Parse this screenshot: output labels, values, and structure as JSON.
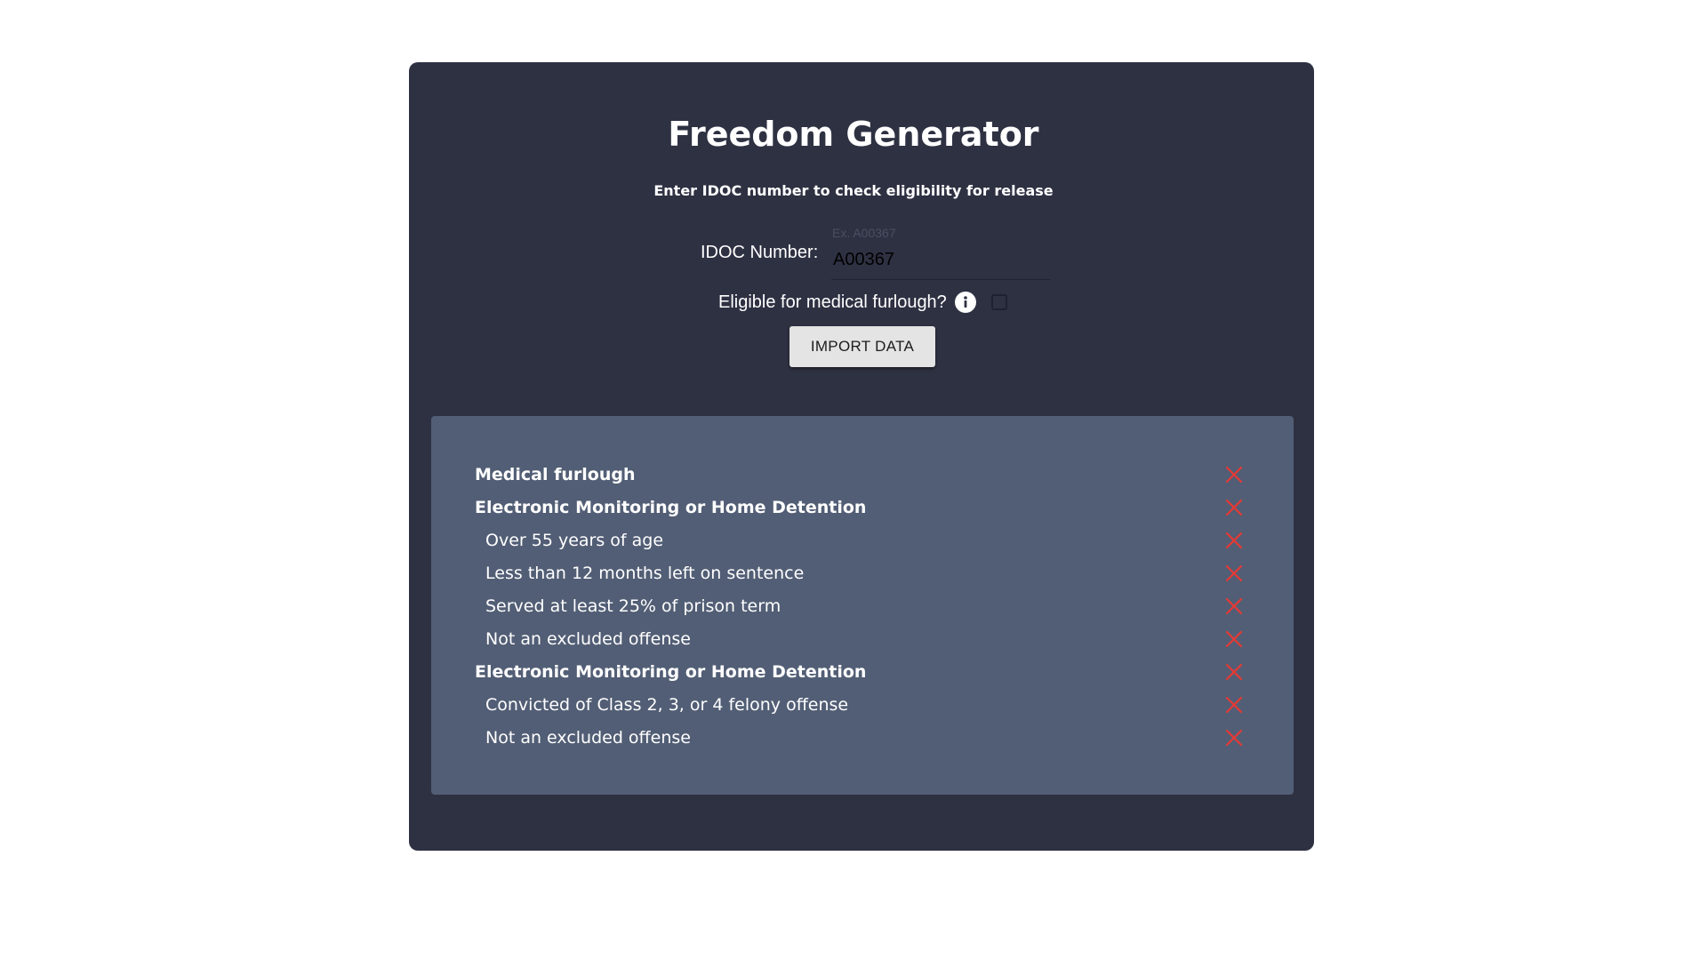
{
  "app": {
    "title": "Freedom Generator",
    "subtitle": "Enter IDOC number to check eligibility for release"
  },
  "form": {
    "idoc_label": "IDOC Number:",
    "idoc_placeholder": "Ex. A00367",
    "idoc_value": "A00367",
    "furlough_label": "Eligible for medical furlough?",
    "furlough_checked": false,
    "info_icon": "info-circle-icon",
    "import_label": "IMPORT DATA"
  },
  "colors": {
    "card_bg": "#2e3142",
    "results_bg": "#525e75",
    "fail_icon": "#e53935"
  },
  "results": [
    {
      "label": "Medical furlough",
      "level": "header",
      "status": "not-eligible",
      "icon": "x-icon"
    },
    {
      "label": "Electronic Monitoring or Home Detention",
      "level": "header",
      "status": "not-eligible",
      "icon": "x-icon"
    },
    {
      "label": "Over 55 years of age",
      "level": "sub",
      "status": "not-eligible",
      "icon": "x-icon"
    },
    {
      "label": "Less than 12 months left on sentence",
      "level": "sub",
      "status": "not-eligible",
      "icon": "x-icon"
    },
    {
      "label": "Served at least 25% of prison term",
      "level": "sub",
      "status": "not-eligible",
      "icon": "x-icon"
    },
    {
      "label": "Not an excluded offense",
      "level": "sub",
      "status": "not-eligible",
      "icon": "x-icon"
    },
    {
      "label": "Electronic Monitoring or Home Detention",
      "level": "header",
      "status": "not-eligible",
      "icon": "x-icon"
    },
    {
      "label": "Convicted of Class 2, 3, or 4 felony offense",
      "level": "sub",
      "status": "not-eligible",
      "icon": "x-icon"
    },
    {
      "label": "Not an excluded offense",
      "level": "sub",
      "status": "not-eligible",
      "icon": "x-icon"
    }
  ]
}
